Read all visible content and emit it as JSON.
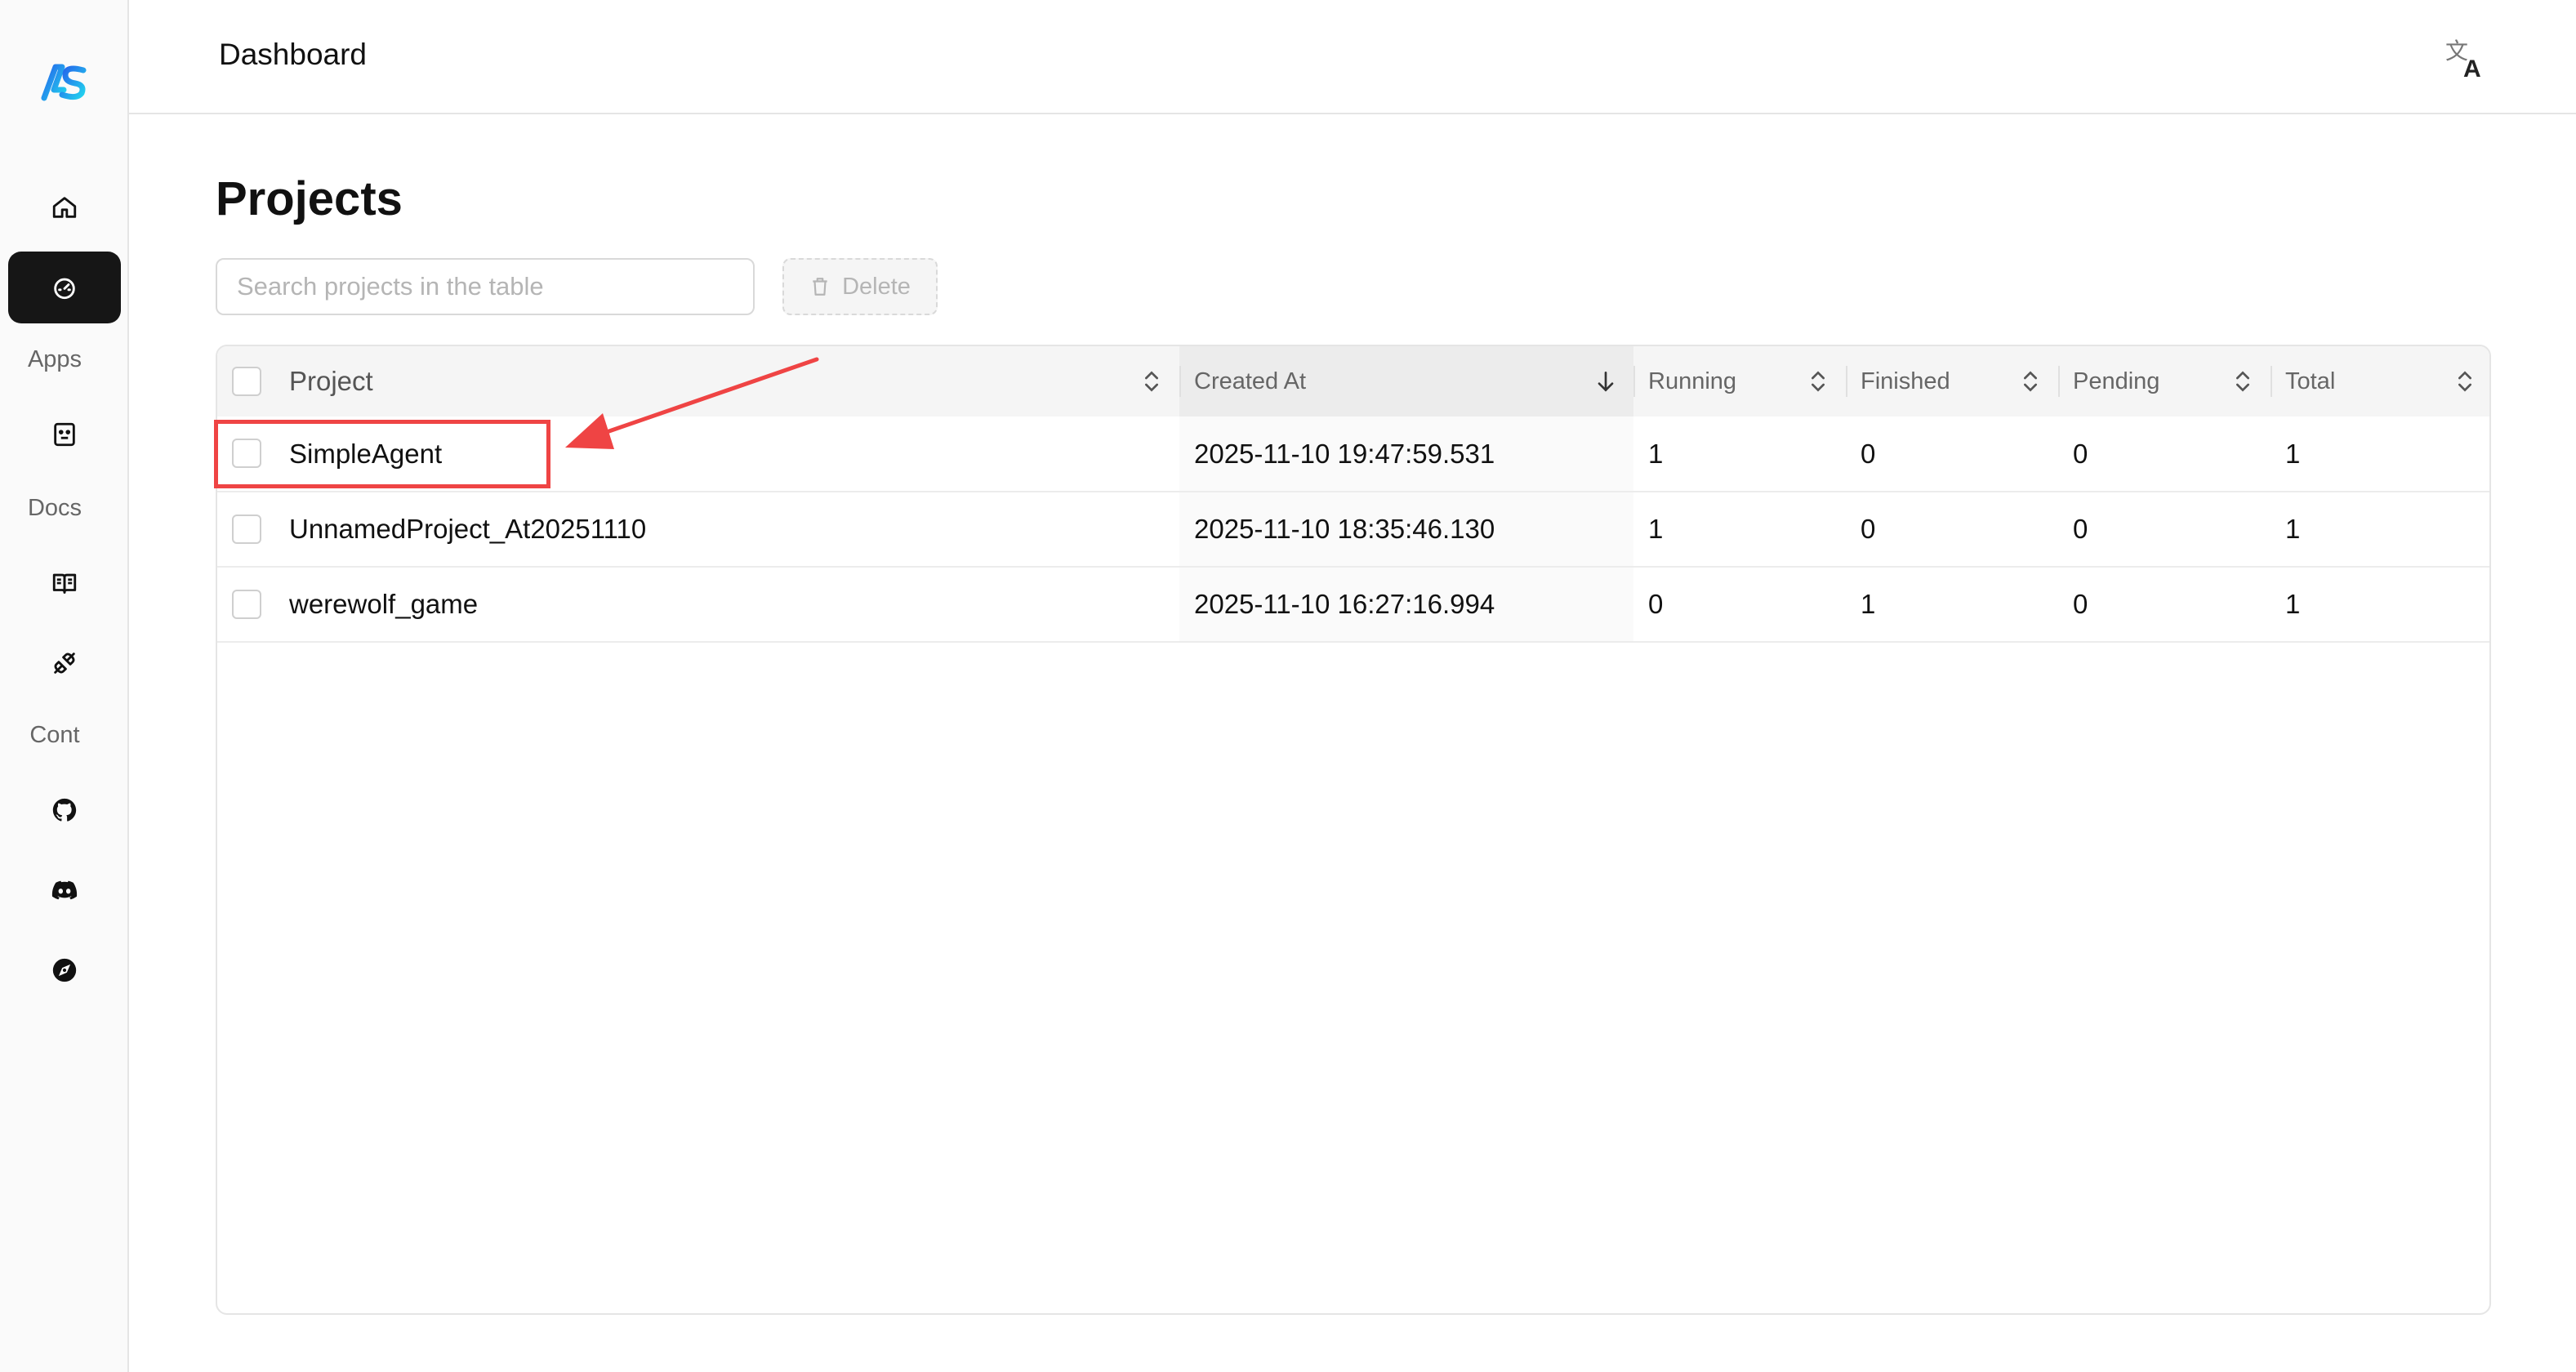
{
  "header": {
    "title": "Dashboard",
    "translate_icon": "translate-icon"
  },
  "sidebar": {
    "logo": "AS",
    "labels": {
      "apps": "Apps",
      "docs": "Docs",
      "cont": "Cont"
    },
    "items": [
      {
        "icon": "home-icon"
      },
      {
        "icon": "dashboard-gauge-icon",
        "active": true
      },
      {
        "icon": "robot-icon"
      },
      {
        "icon": "book-icon"
      },
      {
        "icon": "plug-icon"
      },
      {
        "icon": "github-icon"
      },
      {
        "icon": "discord-icon"
      },
      {
        "icon": "compass-icon"
      }
    ]
  },
  "main": {
    "title": "Projects",
    "search": {
      "placeholder": "Search projects in the table",
      "value": ""
    },
    "delete_label": "Delete"
  },
  "table": {
    "columns": [
      "Project",
      "Created At",
      "Running",
      "Finished",
      "Pending",
      "Total"
    ],
    "rows": [
      {
        "project": "SimpleAgent",
        "created": "2025-11-10 19:47:59.531",
        "running": "1",
        "finished": "0",
        "pending": "0",
        "total": "1"
      },
      {
        "project": "UnnamedProject_At20251110",
        "created": "2025-11-10 18:35:46.130",
        "running": "1",
        "finished": "0",
        "pending": "0",
        "total": "1"
      },
      {
        "project": "werewolf_game",
        "created": "2025-11-10 16:27:16.994",
        "running": "0",
        "finished": "1",
        "pending": "0",
        "total": "1"
      }
    ]
  },
  "colors": {
    "accent": "#161616",
    "annotation": "#ef4444",
    "logo_gradient": [
      "#3b82f6",
      "#22d3ee"
    ]
  }
}
